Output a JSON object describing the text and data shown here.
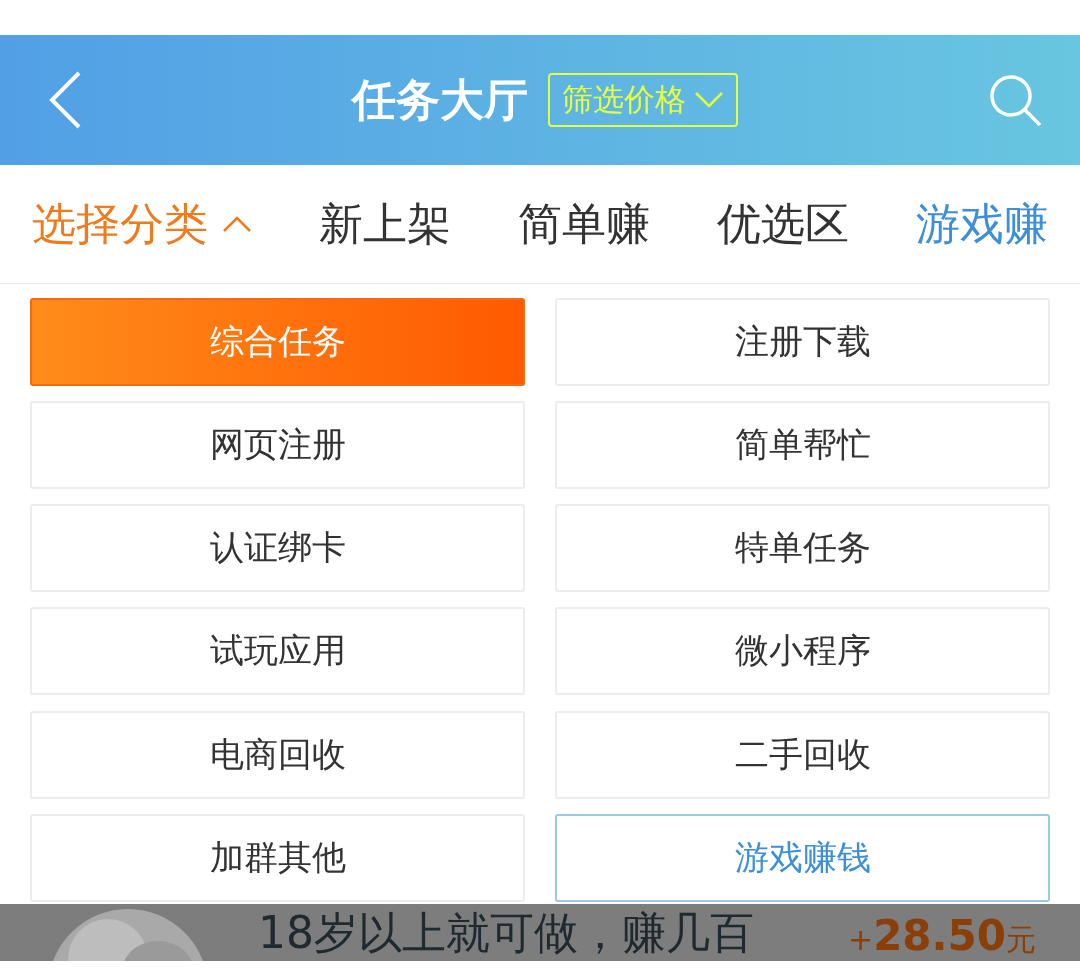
{
  "header": {
    "title": "任务大厅",
    "filter_button": "筛选价格"
  },
  "tabs": [
    {
      "label": "选择分类",
      "kind": "dropdown",
      "expanded": true
    },
    {
      "label": "新上架",
      "kind": "tab",
      "selected": false
    },
    {
      "label": "简单赚",
      "kind": "tab",
      "selected": false
    },
    {
      "label": "优选区",
      "kind": "tab",
      "selected": false
    },
    {
      "label": "游戏赚",
      "kind": "tab",
      "selected": true
    }
  ],
  "categories": [
    {
      "label": "综合任务",
      "selected": true,
      "highlighted": false
    },
    {
      "label": "注册下载",
      "selected": false,
      "highlighted": false
    },
    {
      "label": "网页注册",
      "selected": false,
      "highlighted": false
    },
    {
      "label": "简单帮忙",
      "selected": false,
      "highlighted": false
    },
    {
      "label": "认证绑卡",
      "selected": false,
      "highlighted": false
    },
    {
      "label": "特单任务",
      "selected": false,
      "highlighted": false
    },
    {
      "label": "试玩应用",
      "selected": false,
      "highlighted": false
    },
    {
      "label": "微小程序",
      "selected": false,
      "highlighted": false
    },
    {
      "label": "电商回收",
      "selected": false,
      "highlighted": false
    },
    {
      "label": "二手回收",
      "selected": false,
      "highlighted": false
    },
    {
      "label": "加群其他",
      "selected": false,
      "highlighted": false
    },
    {
      "label": "游戏赚钱",
      "selected": false,
      "highlighted": true
    }
  ],
  "task_preview": {
    "title": "18岁以上就可做，赚几百",
    "price_sign": "+",
    "price": "28.50",
    "unit": "元"
  }
}
